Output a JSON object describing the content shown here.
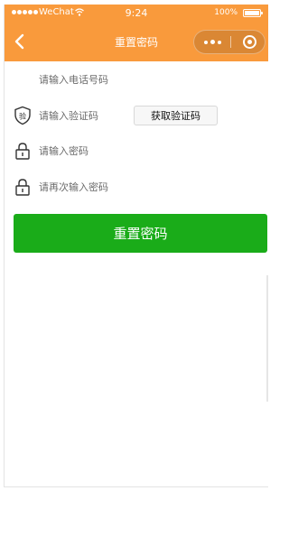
{
  "status_bar": {
    "carrier": "WeChat",
    "time": "9:24",
    "battery": "100%"
  },
  "nav": {
    "title": "重置密码",
    "background": "#f99a3c"
  },
  "form": {
    "phone_placeholder": "请输入电话号码",
    "code_placeholder": "请输入验证码",
    "code_icon_glyph": "验",
    "get_code_label": "获取验证码",
    "password_placeholder": "请输入密码",
    "confirm_placeholder": "请再次输入密码",
    "submit_label": "重置密码"
  },
  "icons": {
    "back": "chevron-left-icon",
    "more": "more-dots-icon",
    "close": "target-close-icon",
    "code": "shield-icon",
    "password": "lock-icon"
  },
  "colors": {
    "accent": "#f99a3c",
    "primary_button": "#1aac19"
  }
}
